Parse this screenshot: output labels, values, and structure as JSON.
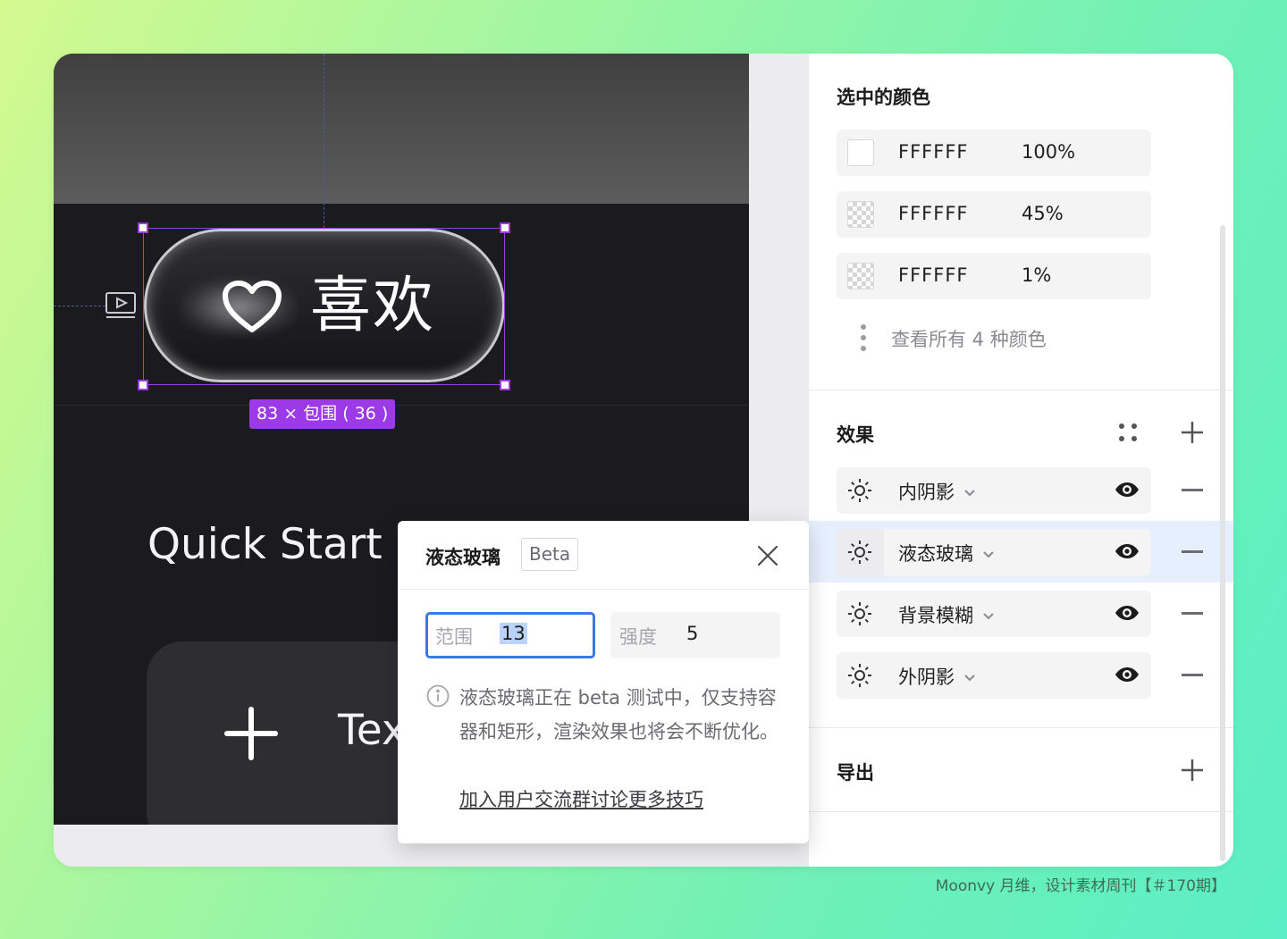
{
  "canvas": {
    "pill_text": "喜欢",
    "size_badge": "83 × 包围 ( 36 )",
    "quick_start": "Quick Start",
    "card_text": "Tex"
  },
  "colors_section": {
    "title": "选中的颜色",
    "items": [
      {
        "hex": "FFFFFF",
        "opacity": "100%"
      },
      {
        "hex": "FFFFFF",
        "opacity": "45%"
      },
      {
        "hex": "FFFFFF",
        "opacity": "1%"
      }
    ],
    "view_all": "查看所有 4 种颜色"
  },
  "effects_section": {
    "title": "效果",
    "items": [
      {
        "label": "内阴影"
      },
      {
        "label": "液态玻璃"
      },
      {
        "label": "背景模糊"
      },
      {
        "label": "外阴影"
      }
    ]
  },
  "export_section": {
    "title": "导出"
  },
  "popup": {
    "title": "液态玻璃",
    "badge": "Beta",
    "range_label": "范围",
    "range_value": "13",
    "strength_label": "强度",
    "strength_value": "5",
    "info": "液态玻璃正在 beta 测试中，仅支持容器和矩形，渲染效果也将会不断优化。",
    "link": "加入用户交流群讨论更多技巧"
  },
  "footer": {
    "credit": "Moonvy 月维，设计素材周刊【＃170期】"
  },
  "theme": {
    "accent": "#9b3ae6",
    "focus": "#3a78e8",
    "highlight": "#e6effd"
  }
}
